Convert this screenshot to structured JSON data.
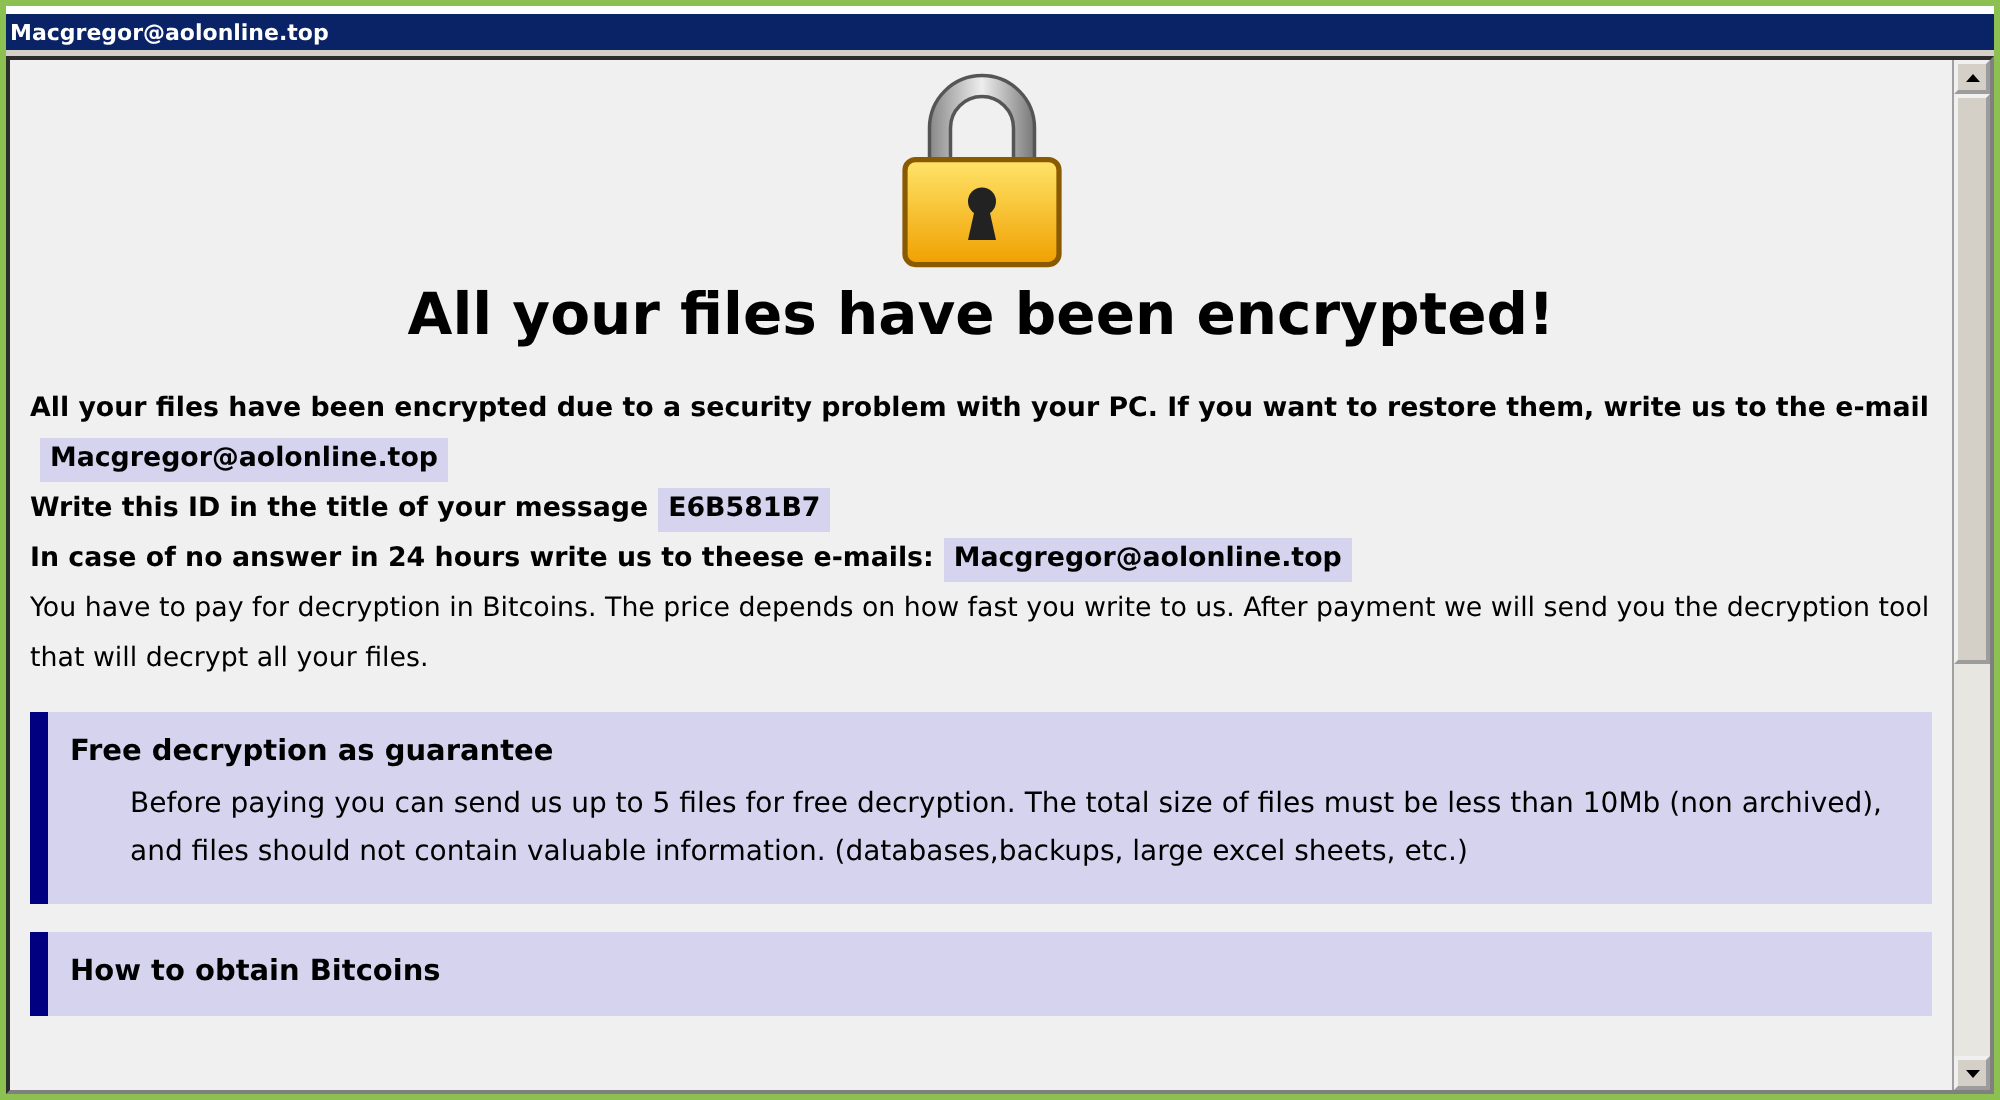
{
  "window": {
    "title": "Macgregor@aolonline.top"
  },
  "heading": "All your files have been encrypted!",
  "notice": [
    {
      "kind": "strong",
      "text": "All your files have been encrypted due to a security problem with your PC. If you want to restore them, write us to the e-mail",
      "tag": "Macgregor@aolonline.top"
    },
    {
      "kind": "strong",
      "text": "Write this ID in the title of your message",
      "tag": "E6B581B7"
    },
    {
      "kind": "strong",
      "text": "In case of no answer in 24 hours write us to theese e-mails:",
      "tag": "Macgregor@aolonline.top"
    },
    {
      "kind": "plain",
      "text": "You have to pay for decryption in Bitcoins. The price depends on how fast you write to us. After payment we will send you the decryption tool that will decrypt all your files."
    }
  ],
  "sections": [
    {
      "title": "Free decryption as guarantee",
      "body": "Before paying you can send us up to 5 files for free decryption. The total size of files must be less than 10Mb (non archived), and files should not contain valuable information. (databases,backups, large excel sheets, etc.)"
    },
    {
      "title": "How to obtain Bitcoins"
    }
  ]
}
